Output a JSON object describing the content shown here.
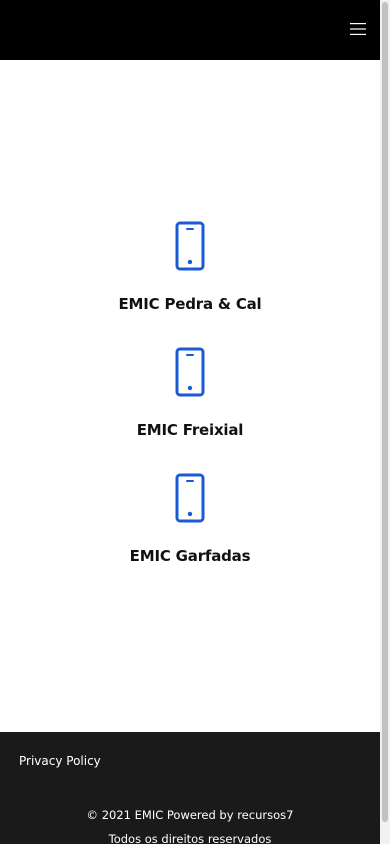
{
  "header": {
    "menu_icon": "hamburger-menu-icon"
  },
  "items": [
    {
      "label": "EMIC Pedra & Cal",
      "icon": "smartphone-icon"
    },
    {
      "label": "EMIC Freixial",
      "icon": "smartphone-icon"
    },
    {
      "label": "EMIC Garfadas",
      "icon": "smartphone-icon"
    }
  ],
  "footer": {
    "privacy_label": "Privacy Policy",
    "copyright": "© 2021 EMIC Powered by recursos7",
    "rights": "Todos os direitos reservados"
  },
  "colors": {
    "header_bg": "#000000",
    "icon_accent": "#1a5ad6",
    "footer_bg": "#1a1a1a"
  }
}
